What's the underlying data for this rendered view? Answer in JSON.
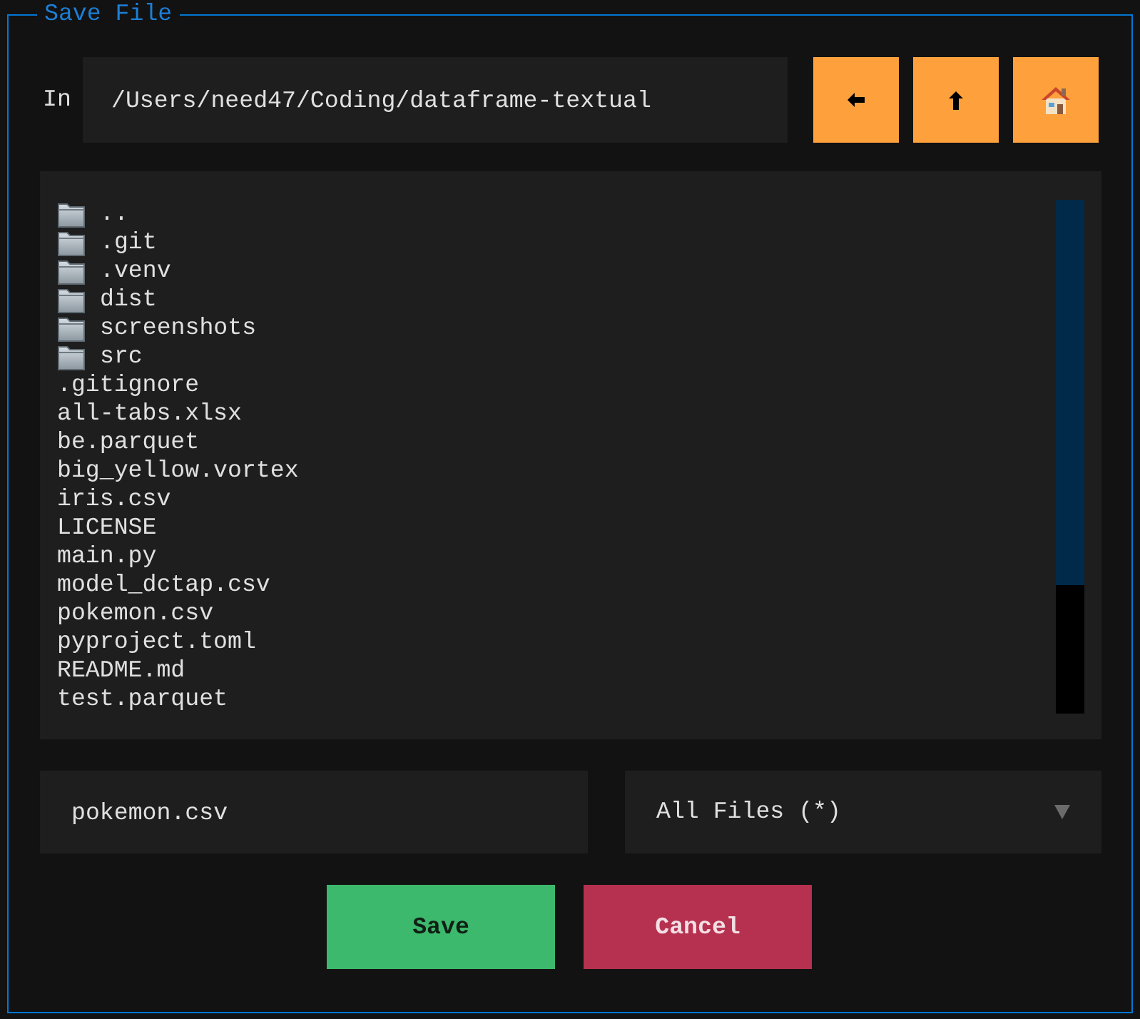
{
  "dialog": {
    "title": "Save File"
  },
  "location": {
    "label": "In",
    "path": "/Users/need47/Coding/dataframe-textual"
  },
  "nav_buttons": [
    {
      "kind": "back"
    },
    {
      "kind": "up"
    },
    {
      "kind": "home"
    }
  ],
  "entries": [
    {
      "name": "..",
      "kind": "folder"
    },
    {
      "name": ".git",
      "kind": "folder"
    },
    {
      "name": ".venv",
      "kind": "folder"
    },
    {
      "name": "dist",
      "kind": "folder"
    },
    {
      "name": "screenshots",
      "kind": "folder"
    },
    {
      "name": "src",
      "kind": "folder"
    },
    {
      "name": ".gitignore",
      "kind": "file"
    },
    {
      "name": "all-tabs.xlsx",
      "kind": "file"
    },
    {
      "name": "be.parquet",
      "kind": "file"
    },
    {
      "name": "big_yellow.vortex",
      "kind": "file"
    },
    {
      "name": "iris.csv",
      "kind": "file"
    },
    {
      "name": "LICENSE",
      "kind": "file"
    },
    {
      "name": "main.py",
      "kind": "file"
    },
    {
      "name": "model_dctap.csv",
      "kind": "file"
    },
    {
      "name": "pokemon.csv",
      "kind": "file"
    },
    {
      "name": "pyproject.toml",
      "kind": "file"
    },
    {
      "name": "README.md",
      "kind": "file"
    },
    {
      "name": "test.parquet",
      "kind": "file"
    }
  ],
  "filename": {
    "value": "pokemon.csv"
  },
  "filter": {
    "value": "All Files (*)"
  },
  "buttons": [
    {
      "label": "Save",
      "kind": "primary"
    },
    {
      "label": "Cancel",
      "kind": "error"
    }
  ]
}
